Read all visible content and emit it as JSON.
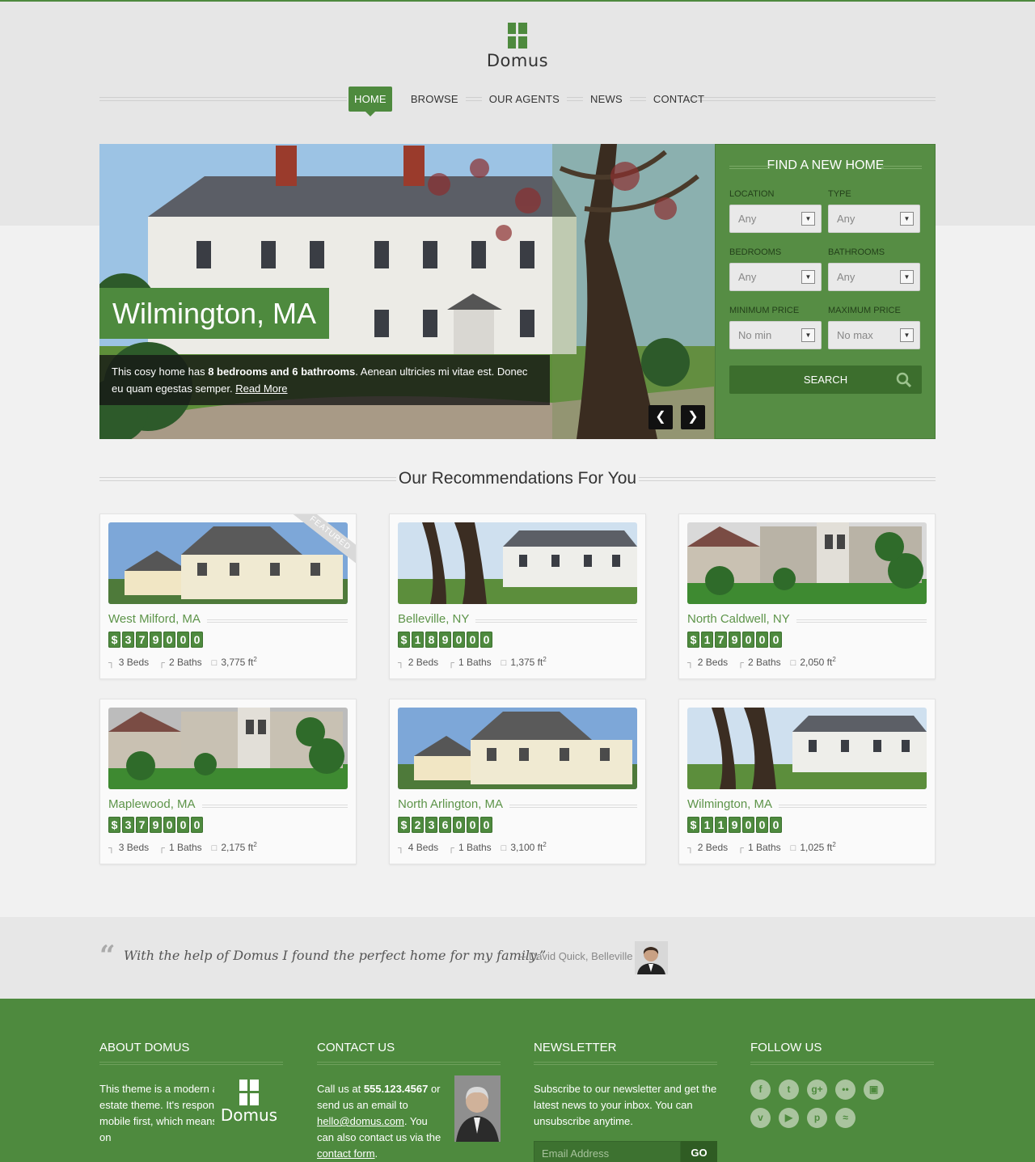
{
  "brand": {
    "name": "Domus",
    "accent": "#4e8a3e"
  },
  "nav": {
    "items": [
      {
        "label": "HOME",
        "active": true
      },
      {
        "label": "BROWSE"
      },
      {
        "label": "OUR AGENTS"
      },
      {
        "label": "NEWS"
      },
      {
        "label": "CONTACT"
      }
    ]
  },
  "hero": {
    "title": "Wilmington, MA",
    "caption_pre": "This cosy home has ",
    "caption_bold": "8 bedrooms and 6 bathrooms",
    "caption_post": ". Aenean ultricies mi vitae est. Donec eu quam egestas semper. ",
    "read_more": "Read More",
    "prev_icon": "chevron-left-icon",
    "next_icon": "chevron-right-icon"
  },
  "search": {
    "title": "FIND A NEW HOME",
    "location_label": "LOCATION",
    "location_value": "Any",
    "type_label": "TYPE",
    "type_value": "Any",
    "bedrooms_label": "BEDROOMS",
    "bedrooms_value": "Any",
    "bathrooms_label": "BATHROOMS",
    "bathrooms_value": "Any",
    "min_price_label": "MINIMUM PRICE",
    "min_price_value": "No min",
    "max_price_label": "MAXIMUM PRICE",
    "max_price_value": "No max",
    "button": "SEARCH"
  },
  "recommendations": {
    "title": "Our Recommendations For You",
    "featured_label": "FEATURED",
    "listings": [
      {
        "city": "West Milford, MA",
        "price_digits": [
          "$",
          "3",
          "7",
          "9",
          "0",
          "0",
          "0"
        ],
        "beds": "3 Beds",
        "baths": "2 Baths",
        "area": "3,775 ft",
        "featured": true
      },
      {
        "city": "Belleville, NY",
        "price_digits": [
          "$",
          "1",
          "8",
          "9",
          "0",
          "0",
          "0"
        ],
        "beds": "2 Beds",
        "baths": "1 Baths",
        "area": "1,375 ft"
      },
      {
        "city": "North Caldwell, NY",
        "price_digits": [
          "$",
          "1",
          "7",
          "9",
          "0",
          "0",
          "0"
        ],
        "beds": "2 Beds",
        "baths": "2 Baths",
        "area": "2,050 ft"
      },
      {
        "city": "Maplewood, MA",
        "price_digits": [
          "$",
          "3",
          "7",
          "9",
          "0",
          "0",
          "0"
        ],
        "beds": "3 Beds",
        "baths": "1 Baths",
        "area": "2,175 ft"
      },
      {
        "city": "North Arlington, MA",
        "price_digits": [
          "$",
          "2",
          "3",
          "6",
          "0",
          "0",
          "0"
        ],
        "beds": "4 Beds",
        "baths": "1 Baths",
        "area": "3,100 ft"
      },
      {
        "city": "Wilmington, MA",
        "price_digits": [
          "$",
          "1",
          "1",
          "9",
          "0",
          "0",
          "0"
        ],
        "beds": "2 Beds",
        "baths": "1 Baths",
        "area": "1,025 ft"
      }
    ],
    "area_sup": "2"
  },
  "testimonial": {
    "quote": "With the help of Domus I found the perfect home for my family.”",
    "author": "– David Quick, Belleville"
  },
  "footer": {
    "about_title": "ABOUT DOMUS",
    "about_text": "This theme is a modern and stylish real estate theme. It's responsive and built mobile first, which means that it works on",
    "contact_title": "CONTACT US",
    "contact_pre": "Call us at ",
    "contact_phone": "555.123.4567",
    "contact_mid": " or send us an email to ",
    "contact_email": "hello@domus.com",
    "contact_post": ". You can also contact us via the ",
    "contact_form": "contact form",
    "contact_end": ".",
    "newsletter_title": "NEWSLETTER",
    "newsletter_text": "Subscribe to our newsletter and get the latest news to your inbox. You can unsubscribe anytime.",
    "newsletter_placeholder": "Email Address",
    "newsletter_button": "GO",
    "follow_title": "FOLLOW US",
    "social_icons": [
      "facebook-icon",
      "twitter-icon",
      "google-plus-icon",
      "flickr-icon",
      "instagram-icon",
      "vimeo-icon",
      "youtube-icon",
      "pinterest-icon",
      "rss-icon"
    ]
  }
}
